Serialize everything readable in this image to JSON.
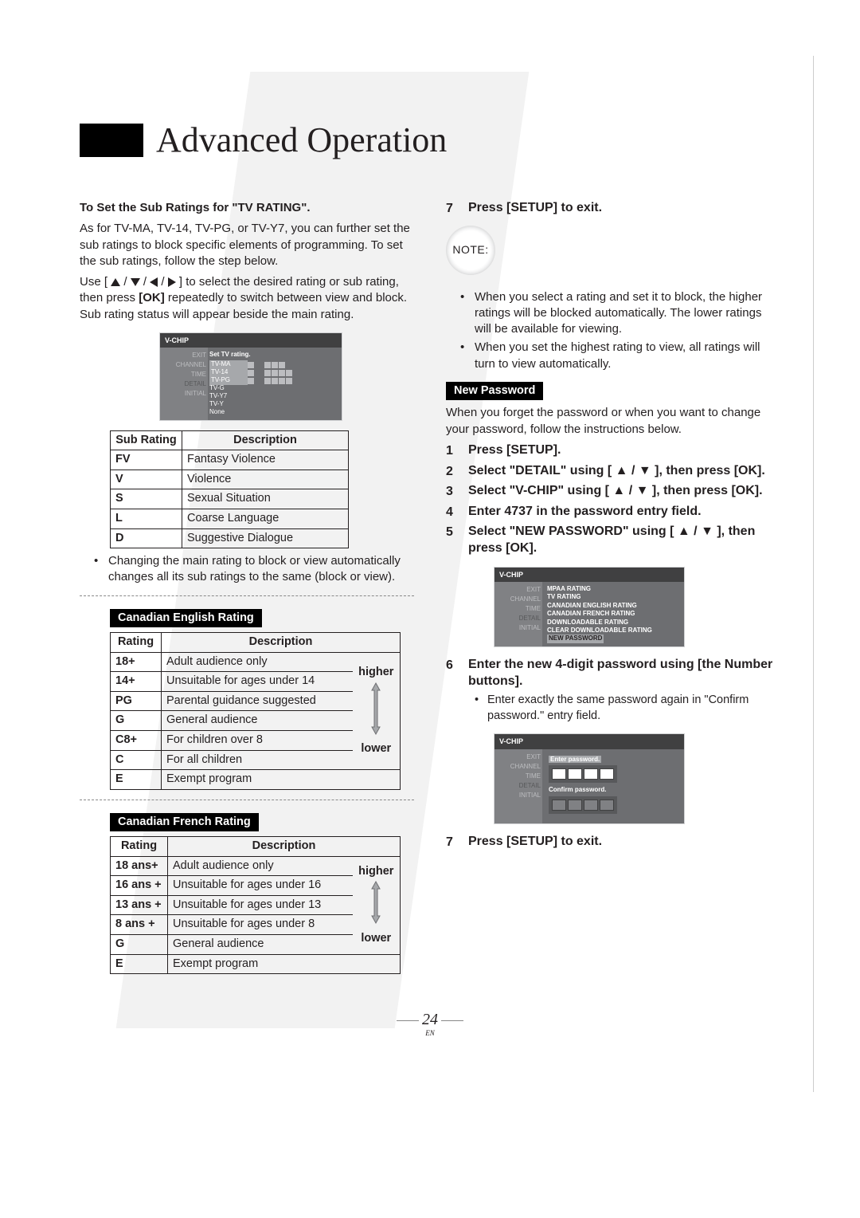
{
  "page": {
    "title": "Advanced Operation",
    "number": "24",
    "lang": "EN"
  },
  "left": {
    "sub_heading": "To Set the Sub Ratings for \"TV RATING\".",
    "para1": "As for TV-MA, TV-14, TV-PG, or TV-Y7, you can further set the sub ratings to block specific elements of programming. To set the sub ratings, follow the step below.",
    "para2a": "Use [ ",
    "para2b": " ] to select the desired rating or sub rating, then press ",
    "para2_ok": "[OK]",
    "para2c": " repeatedly to switch between view and block. Sub rating status will appear beside the main rating.",
    "osd1": {
      "title": "V-CHIP",
      "caption": "Set TV rating.",
      "side": {
        "exit": "EXIT",
        "channel": "CHANNEL",
        "time": "TIME",
        "detail": "DETAIL",
        "initial": "INITIAL"
      },
      "rows": [
        "TV-MA",
        "TV-14",
        "TV-PG",
        "TV-G",
        "TV-Y7",
        "TV-Y",
        "None"
      ]
    },
    "table1": {
      "h1": "Sub Rating",
      "h2": "Description",
      "rows": [
        [
          "FV",
          "Fantasy Violence"
        ],
        [
          "V",
          "Violence"
        ],
        [
          "S",
          "Sexual Situation"
        ],
        [
          "L",
          "Coarse Language"
        ],
        [
          "D",
          "Suggestive Dialogue"
        ]
      ]
    },
    "bullet1": "Changing the main rating to block or view automatically changes all its sub ratings to the same (block or view).",
    "section2": "Canadian English Rating",
    "table2": {
      "h1": "Rating",
      "h2": "Description",
      "higher": "higher",
      "lower": "lower",
      "rows": [
        [
          "18+",
          "Adult audience only"
        ],
        [
          "14+",
          "Unsuitable for ages under 14"
        ],
        [
          "PG",
          "Parental guidance suggested"
        ],
        [
          "G",
          "General audience"
        ],
        [
          "C8+",
          "For children over 8"
        ],
        [
          "C",
          "For all children"
        ],
        [
          "E",
          "Exempt program"
        ]
      ]
    },
    "section3": "Canadian French Rating",
    "table3": {
      "h1": "Rating",
      "h2": "Description",
      "higher": "higher",
      "lower": "lower",
      "rows": [
        [
          "18 ans+",
          "Adult audience only"
        ],
        [
          "16 ans +",
          "Unsuitable for ages under 16"
        ],
        [
          "13 ans +",
          "Unsuitable for ages under 13"
        ],
        [
          "8 ans +",
          "Unsuitable for ages under 8"
        ],
        [
          "G",
          "General audience"
        ],
        [
          "E",
          "Exempt program"
        ]
      ]
    }
  },
  "right": {
    "step7a": {
      "n": "7",
      "t": "Press [SETUP] to exit."
    },
    "note_label": "NOTE:",
    "notes": [
      "When you select a rating and set it to block, the higher ratings will be blocked automatically. The lower ratings will be available for viewing.",
      "When you set the highest rating to view, all ratings will turn to view automatically."
    ],
    "newpw_heading": "New Password",
    "newpw_intro": "When you forget the password or when you want to change your password, follow the instructions below.",
    "steps": [
      {
        "n": "1",
        "t": "Press [SETUP]."
      },
      {
        "n": "2",
        "t": "Select \"DETAIL\" using [ ▲ / ▼ ], then press [OK]."
      },
      {
        "n": "3",
        "t": "Select \"V-CHIP\" using [ ▲ / ▼ ], then press [OK]."
      },
      {
        "n": "4",
        "t": "Enter 4737 in the password entry field."
      },
      {
        "n": "5",
        "t": "Select \"NEW PASSWORD\" using [ ▲ / ▼ ], then press [OK]."
      }
    ],
    "osd2": {
      "title": "V-CHIP",
      "side": {
        "exit": "EXIT",
        "channel": "CHANNEL",
        "time": "TIME",
        "detail": "DETAIL",
        "initial": "INITIAL"
      },
      "items": [
        "MPAA RATING",
        "TV RATING",
        "CANADIAN ENGLISH RATING",
        "CANADIAN FRENCH RATING",
        "DOWNLOADABLE RATING",
        "CLEAR DOWNLOADABLE RATING",
        "NEW PASSWORD"
      ]
    },
    "step6": {
      "n": "6",
      "t": "Enter the new 4-digit password using [the Number buttons]."
    },
    "step6_sub": "Enter exactly the same password again in \"Confirm password.\" entry field.",
    "osd3": {
      "title": "V-CHIP",
      "side": {
        "exit": "EXIT",
        "channel": "CHANNEL",
        "time": "TIME",
        "detail": "DETAIL",
        "initial": "INITIAL"
      },
      "enter": "Enter password.",
      "confirm": "Confirm password."
    },
    "step7b": {
      "n": "7",
      "t": "Press [SETUP] to exit."
    }
  }
}
